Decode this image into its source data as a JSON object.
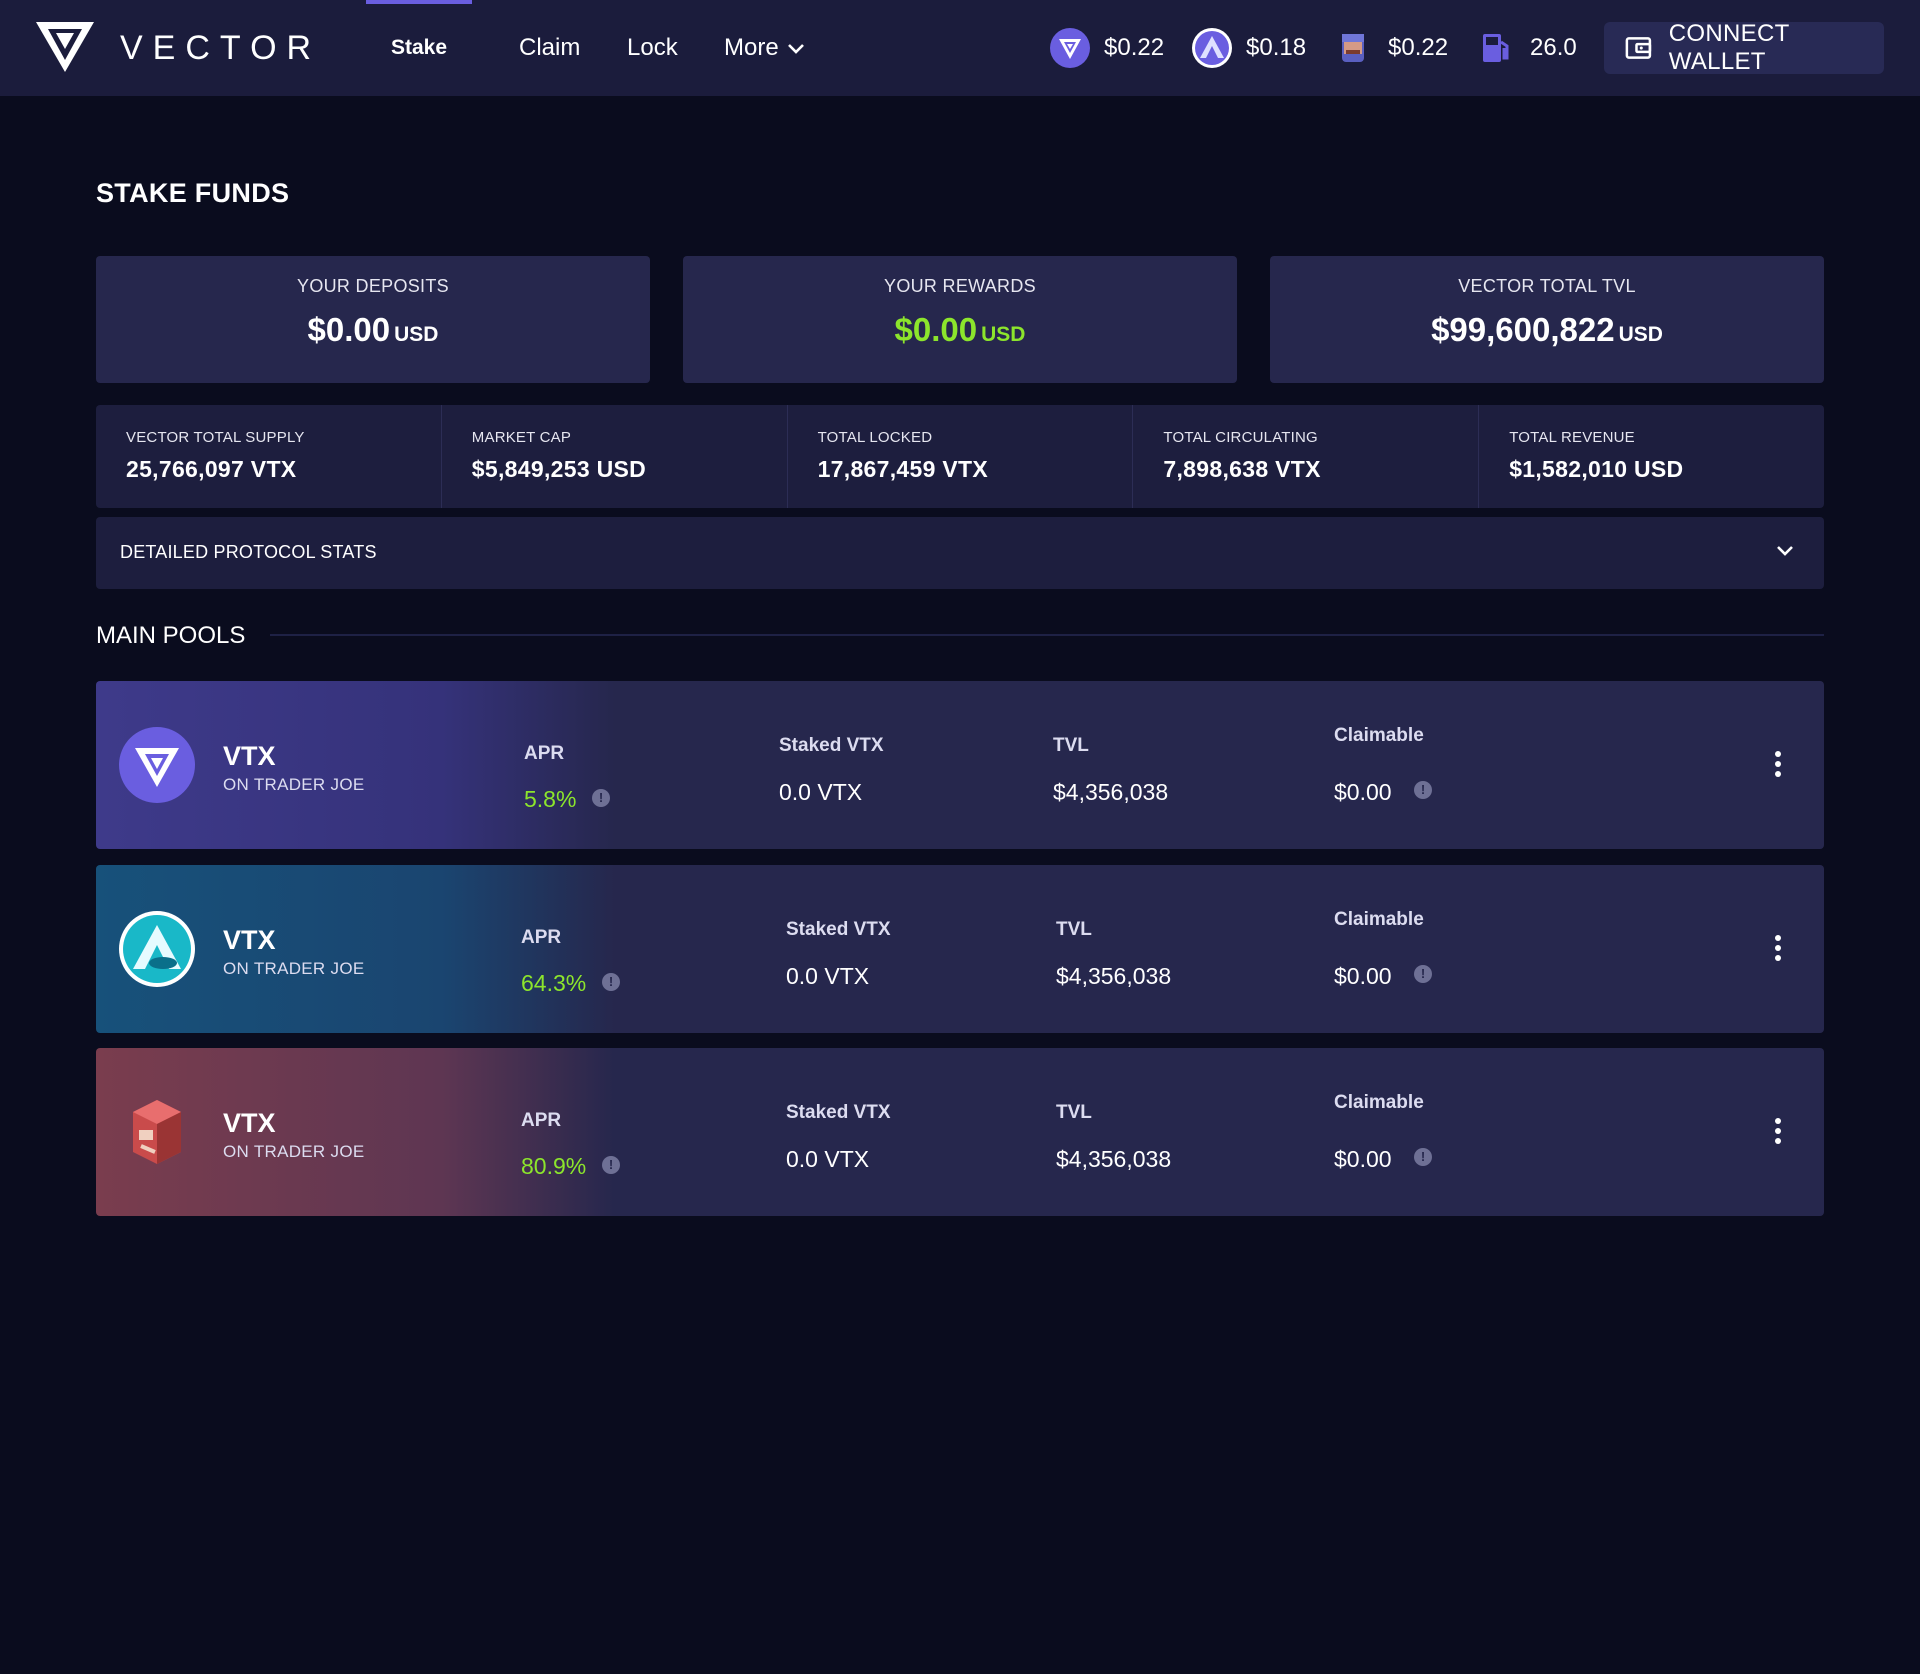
{
  "header": {
    "brand": "VECTOR",
    "nav": [
      {
        "label": "Stake",
        "active": true
      },
      {
        "label": "Claim"
      },
      {
        "label": "Lock"
      },
      {
        "label": "More"
      }
    ],
    "tickers": [
      {
        "icon": "vector-token-icon",
        "value": "$0.22"
      },
      {
        "icon": "mountain-token-icon",
        "value": "$0.18"
      },
      {
        "icon": "joe-token-icon",
        "value": "$0.22"
      },
      {
        "icon": "gas-pump-icon",
        "value": "26.0"
      }
    ],
    "connect_label": "CONNECT WALLET"
  },
  "page": {
    "title": "STAKE FUNDS",
    "summary": [
      {
        "label": "YOUR DEPOSITS",
        "amount": "$0.00",
        "unit": "USD"
      },
      {
        "label": "YOUR REWARDS",
        "amount": "$0.00",
        "unit": "USD",
        "color": "#8ce52c"
      },
      {
        "label": "VECTOR TOTAL TVL",
        "amount": "$99,600,822",
        "unit": "USD"
      }
    ],
    "stats": [
      {
        "label": "VECTOR TOTAL SUPPLY",
        "value": "25,766,097 VTX"
      },
      {
        "label": "MARKET CAP",
        "value": "$5,849,253 USD"
      },
      {
        "label": "TOTAL LOCKED",
        "value": "17,867,459 VTX"
      },
      {
        "label": "TOTAL CIRCULATING",
        "value": "7,898,638 VTX"
      },
      {
        "label": "TOTAL REVENUE",
        "value": "$1,582,010 USD"
      }
    ],
    "detailed_label": "DETAILED PROTOCOL STATS",
    "section_title": "MAIN POOLS"
  },
  "pools": [
    {
      "icon": "vector-token-icon",
      "name": "VTX",
      "sub": "ON TRADER JOE",
      "apr_label": "APR",
      "apr": "5.8%",
      "staked_label": "Staked VTX",
      "staked": "0.0 VTX",
      "tvl_label": "TVL",
      "tvl": "$4,356,038",
      "claimable_label": "Claimable",
      "claimable": "$0.00"
    },
    {
      "icon": "mountain-token-icon",
      "name": "VTX",
      "sub": "ON TRADER JOE",
      "apr_label": "APR",
      "apr": "64.3%",
      "staked_label": "Staked VTX",
      "staked": "0.0 VTX",
      "tvl_label": "TVL",
      "tvl": "$4,356,038",
      "claimable_label": "Claimable",
      "claimable": "$0.00"
    },
    {
      "icon": "joe-token-icon",
      "name": "VTX",
      "sub": "ON TRADER JOE",
      "apr_label": "APR",
      "apr": "80.9%",
      "staked_label": "Staked VTX",
      "staked": "0.0 VTX",
      "tvl_label": "TVL",
      "tvl": "$4,356,038",
      "claimable_label": "Claimable",
      "claimable": "$0.00"
    }
  ],
  "colors": {
    "background": "#0a0c1e",
    "header": "#1b1c3c",
    "card": "#26274d",
    "accent": "#6a5ee0",
    "positive": "#8ce52c"
  }
}
